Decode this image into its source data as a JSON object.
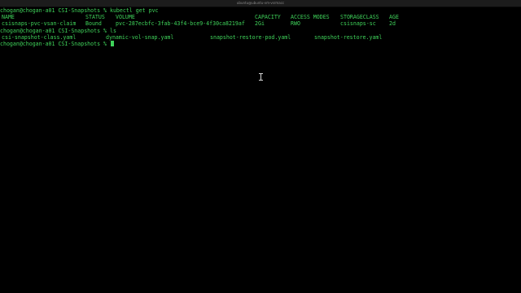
{
  "window": {
    "title": "ubuntu@ubuntu-vm-vsrmacc"
  },
  "terminal": {
    "prompt": "chogan@chogan-a01 CSI-Snapshots % ",
    "command1": "kubectl get pvc",
    "pvc_table": {
      "headers": [
        "NAME",
        "STATUS",
        "VOLUME",
        "CAPACITY",
        "ACCESS MODES",
        "STORAGECLASS",
        "AGE"
      ],
      "rows": [
        [
          "csisnaps-pvc-vsan-claim",
          "Bound",
          "pvc-287ecbfc-3fab-43f4-bce9-4f30ca8219af",
          "2Gi",
          "RWO",
          "csisnaps-sc",
          "2d"
        ]
      ]
    },
    "command2": "ls",
    "ls_output": [
      "csi-snapshot-class.yaml",
      "dynamic-vol-snap.yaml",
      "snapshot-restore-pod.yaml",
      "snapshot-restore.yaml"
    ]
  },
  "colors": {
    "terminal_text": "#3fd35a",
    "background": "#000000"
  },
  "icons": {
    "pointer": "text-ibeam-cursor"
  }
}
